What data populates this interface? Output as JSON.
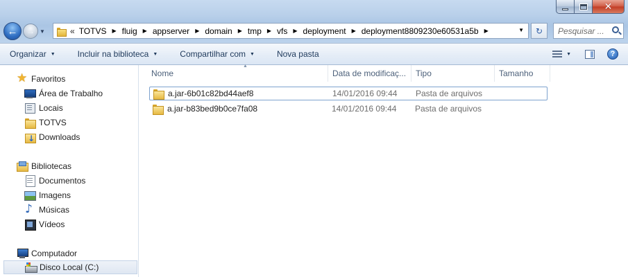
{
  "window": {
    "controls": {
      "minimize": "minimize",
      "maximize": "maximize",
      "close": "✕"
    }
  },
  "address_bar": {
    "overflow": "«",
    "crumbs": [
      "TOTVS",
      "fluig",
      "appserver",
      "domain",
      "tmp",
      "vfs",
      "deployment",
      "deployment8809230e60531a5b"
    ]
  },
  "search": {
    "placeholder": "Pesquisar ..."
  },
  "command_bar": {
    "organize": "Organizar",
    "include_library": "Incluir na biblioteca",
    "share": "Compartilhar com",
    "new_folder": "Nova pasta",
    "help": "?"
  },
  "nav_pane": {
    "favorites": {
      "label": "Favoritos",
      "items": [
        {
          "label": "Área de Trabalho",
          "icon": "desktop-icon"
        },
        {
          "label": "Locais",
          "icon": "recent-places-icon"
        },
        {
          "label": "TOTVS",
          "icon": "folder-icon"
        },
        {
          "label": "Downloads",
          "icon": "downloads-icon"
        }
      ]
    },
    "libraries": {
      "label": "Bibliotecas",
      "items": [
        {
          "label": "Documentos",
          "icon": "documents-icon"
        },
        {
          "label": "Imagens",
          "icon": "pictures-icon"
        },
        {
          "label": "Músicas",
          "icon": "music-icon"
        },
        {
          "label": "Vídeos",
          "icon": "videos-icon"
        }
      ]
    },
    "computer": {
      "label": "Computador",
      "items": [
        {
          "label": "Disco Local (C:)",
          "icon": "local-disk-icon"
        }
      ]
    }
  },
  "file_list": {
    "columns": [
      "Nome",
      "Data de modificaç...",
      "Tipo",
      "Tamanho"
    ],
    "rows": [
      {
        "name": "a.jar-6b01c82bd44aef8",
        "date": "14/01/2016 09:44",
        "type": "Pasta de arquivos",
        "size": ""
      },
      {
        "name": "a.jar-b83bed9b0ce7fa08",
        "date": "14/01/2016 09:44",
        "type": "Pasta de arquivos",
        "size": ""
      }
    ]
  }
}
